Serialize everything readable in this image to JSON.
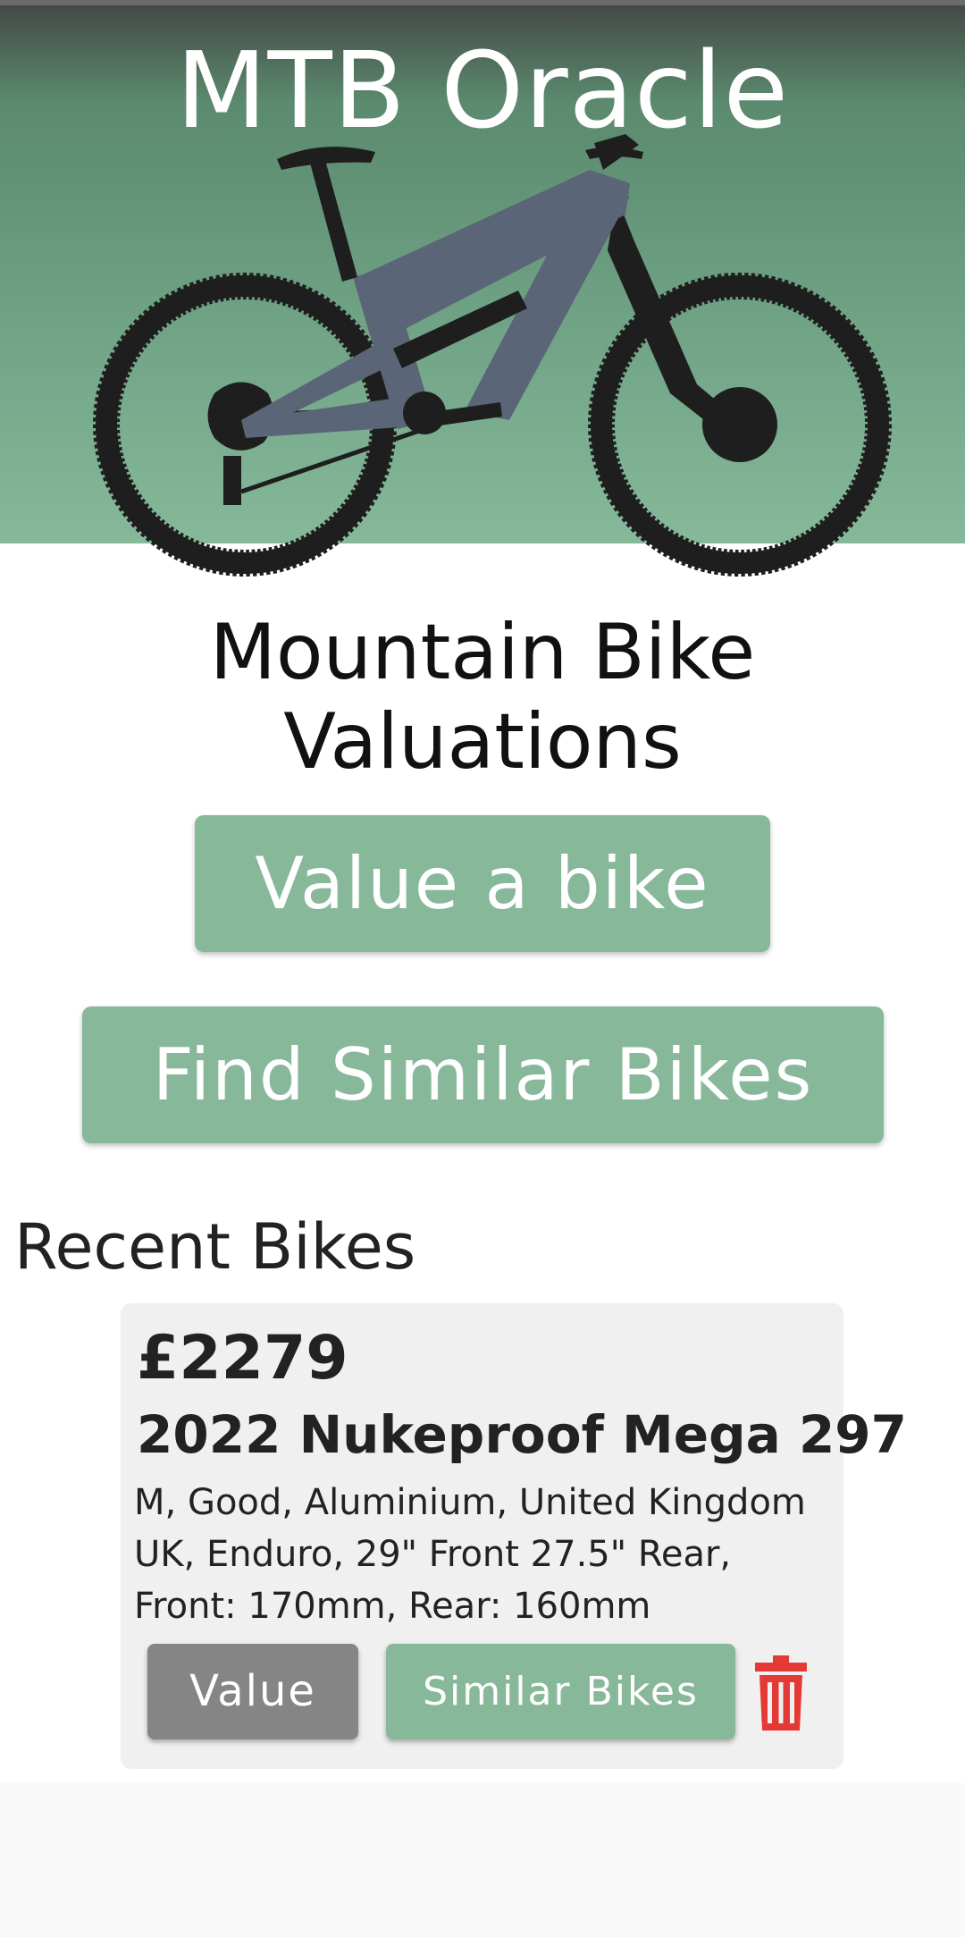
{
  "header": {
    "app_title": "MTB Oracle"
  },
  "hero": {
    "image": "mountain-bike-illustration",
    "subtitle": "Mountain Bike Valuations"
  },
  "actions": {
    "value_bike_label": "Value a bike",
    "find_similar_label": "Find Similar Bikes"
  },
  "recent": {
    "heading": "Recent Bikes",
    "items": [
      {
        "price": "£2279",
        "name": "2022 Nukeproof Mega 297",
        "details": "M, Good, Aluminium, United Kingdom UK, Enduro, 29\" Front 27.5\" Rear, Front: 170mm, Rear: 160mm",
        "value_label": "Value",
        "similar_label": "Similar Bikes",
        "delete_icon": "trash-icon"
      }
    ]
  },
  "colors": {
    "accent": "#87b89a",
    "secondary_button": "#858585",
    "delete": "#e53935",
    "bike_frame": "#5a6577",
    "bike_tires": "#1e1e1e"
  }
}
